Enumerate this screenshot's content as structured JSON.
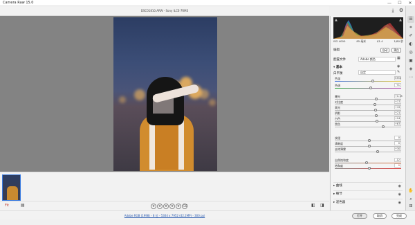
{
  "window": {
    "title": "Camera Raw 15.0"
  },
  "file": {
    "name": "DSC01810.ARW - Sony ILCE-7RM3"
  },
  "viewer": {
    "zoom": "Fit"
  },
  "rating": {
    "stars": 0,
    "max": 5
  },
  "info": {
    "text": "Adobe RGB (1998) - 8 位 - 5304 x 7952 (42.2MP) - 300 ppi"
  },
  "buttons": {
    "open": "打开",
    "cancel": "取消",
    "done": "完成"
  },
  "histogram": {
    "iso": "ISO 4000",
    "lens": "85 毫米",
    "aperture": "f/1.4",
    "shutter": "1/80 秒"
  },
  "panel": {
    "title": "编辑",
    "auto": "自动",
    "bw": "黑白",
    "profile_label": "配置文件",
    "profile_value": "Adobe 颜色",
    "basic": "基本",
    "wb_label": "白平衡",
    "wb_value": "自定",
    "sliders": [
      {
        "label": "色温",
        "value": "5350"
      },
      {
        "label": "色调",
        "value": "+1"
      },
      {
        "label": "曝光",
        "value": "+0.15"
      },
      {
        "label": "对比度",
        "value": "+17"
      },
      {
        "label": "高光",
        "value": "+19"
      },
      {
        "label": "阴影",
        "value": "+21"
      },
      {
        "label": "白色",
        "value": "+24"
      },
      {
        "label": "黑色",
        "value": "+67"
      },
      {
        "label": "纹理",
        "value": "0"
      },
      {
        "label": "清晰度",
        "value": "0"
      },
      {
        "label": "去除薄雾",
        "value": "+30"
      },
      {
        "label": "自然饱和度",
        "value": "-12"
      },
      {
        "label": "饱和度",
        "value": "0"
      }
    ],
    "sections": [
      "曲线",
      "细节",
      "混色器"
    ]
  },
  "colors": {
    "accent": "#3a7be0",
    "value_red": "#c0392b"
  }
}
